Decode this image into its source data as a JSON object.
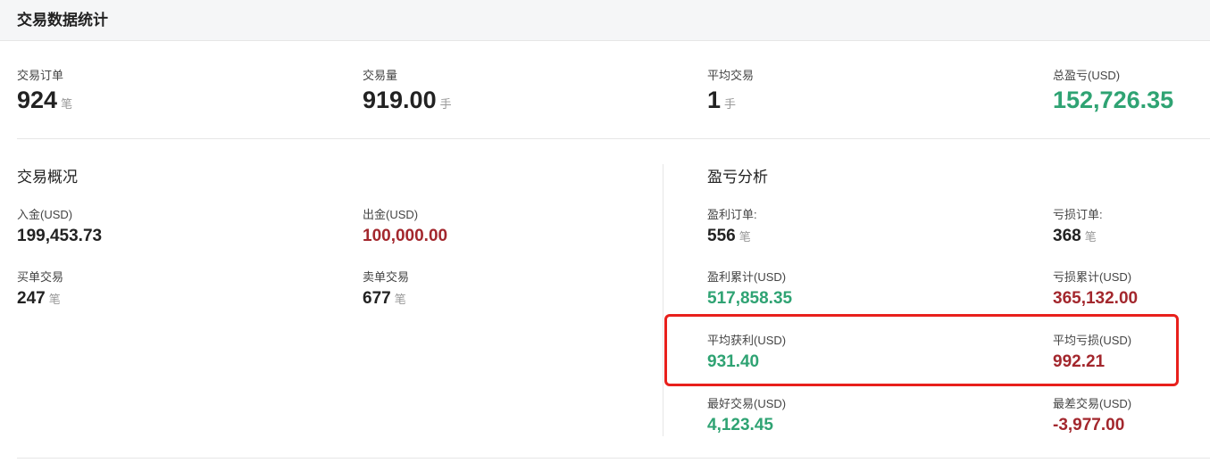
{
  "header": {
    "title": "交易数据统计"
  },
  "summary": {
    "orders": {
      "label": "交易订单",
      "value": "924",
      "unit": "笔"
    },
    "volume": {
      "label": "交易量",
      "value": "919.00",
      "unit": "手"
    },
    "avg": {
      "label": "平均交易",
      "value": "1",
      "unit": "手"
    },
    "pnl": {
      "label": "总盈亏(USD)",
      "value": "152,726.35"
    }
  },
  "overview": {
    "title": "交易概况",
    "deposit": {
      "label": "入金(USD)",
      "value": "199,453.73"
    },
    "withdraw": {
      "label": "出金(USD)",
      "value": "100,000.00"
    },
    "buy": {
      "label": "买单交易",
      "value": "247",
      "unit": "笔"
    },
    "sell": {
      "label": "卖单交易",
      "value": "677",
      "unit": "笔"
    }
  },
  "analysis": {
    "title": "盈亏分析",
    "profit_orders": {
      "label": "盈利订单:",
      "value": "556",
      "unit": "笔"
    },
    "loss_orders": {
      "label": "亏损订单:",
      "value": "368",
      "unit": "笔"
    },
    "profit_total": {
      "label": "盈利累计(USD)",
      "value": "517,858.35"
    },
    "loss_total": {
      "label": "亏损累计(USD)",
      "value": "365,132.00"
    },
    "avg_profit": {
      "label": "平均获利(USD)",
      "value": "931.40"
    },
    "avg_loss": {
      "label": "平均亏损(USD)",
      "value": "992.21"
    },
    "best": {
      "label": "最好交易(USD)",
      "value": "4,123.45"
    },
    "worst": {
      "label": "最差交易(USD)",
      "value": "-3,977.00"
    }
  },
  "colors": {
    "positive": "#2fa373",
    "negative": "#a3272d",
    "highlight": "#e8201c"
  }
}
